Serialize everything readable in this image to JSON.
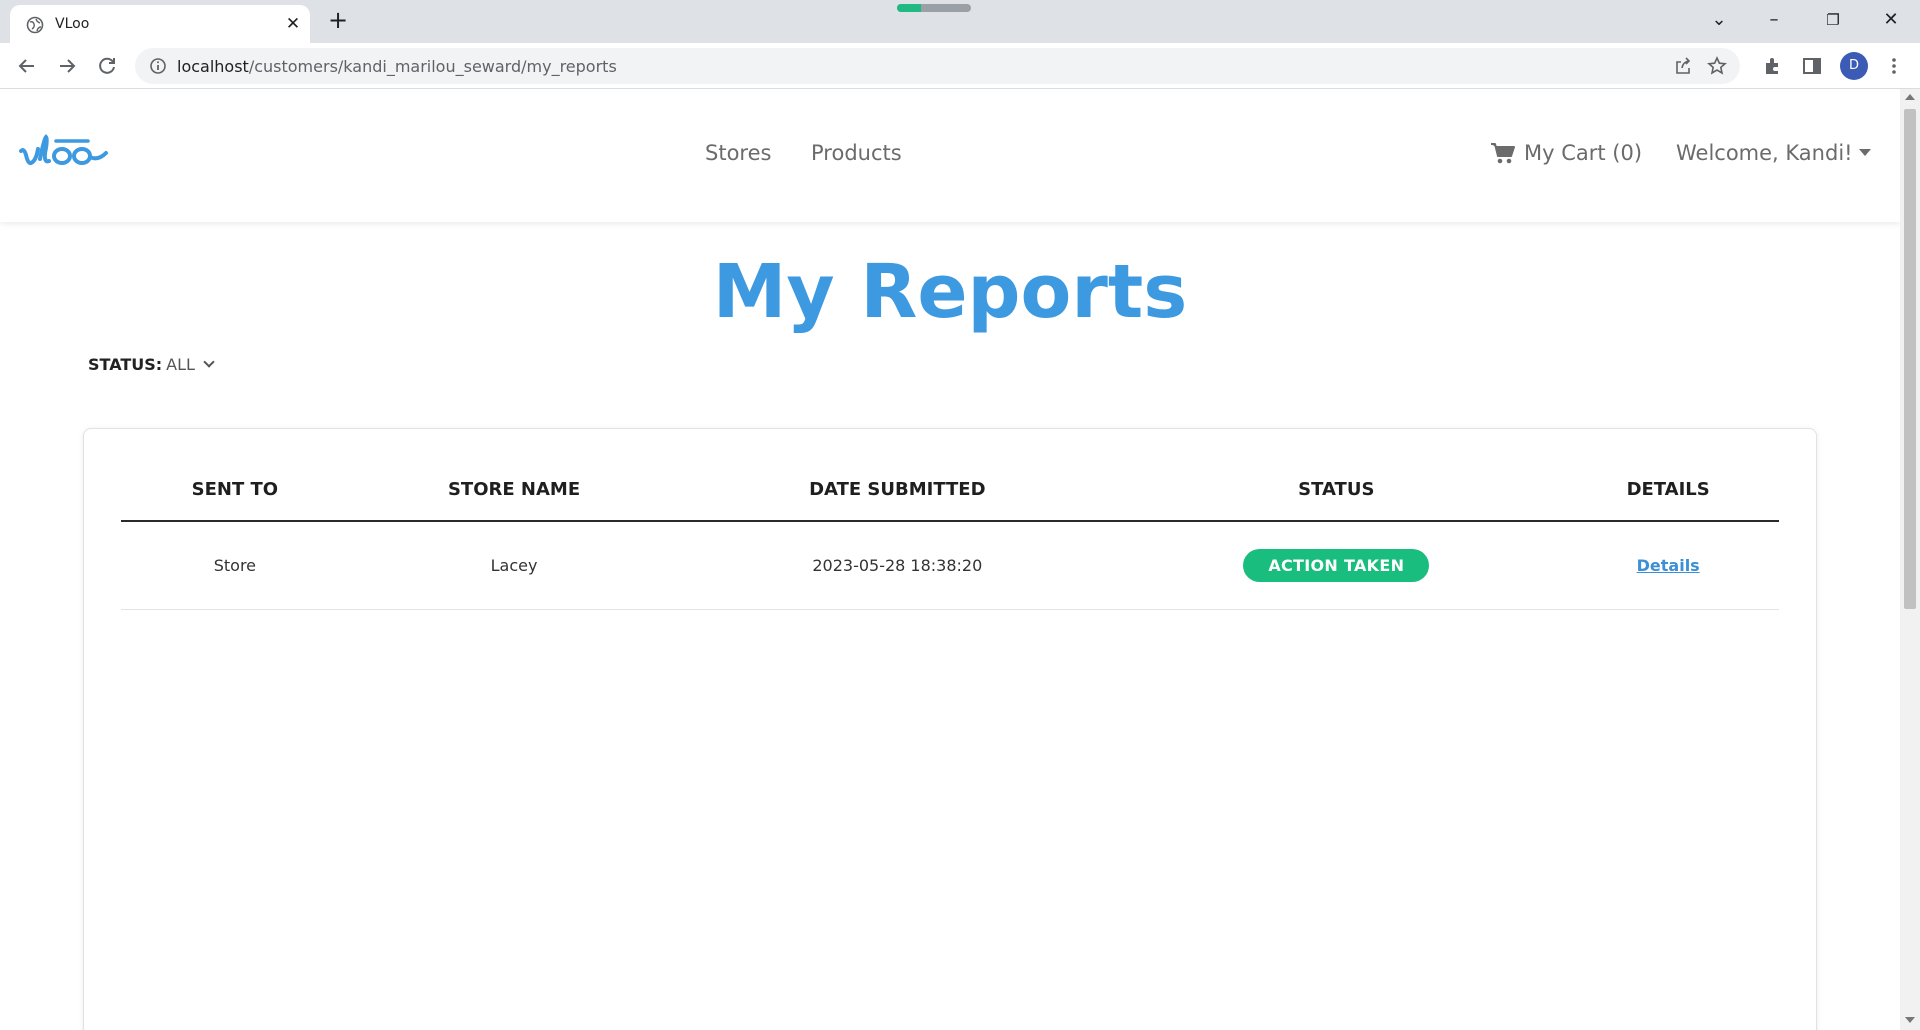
{
  "browser": {
    "tab_title": "VLoo",
    "url_host": "localhost",
    "url_path": "/customers/kandi_marilou_seward/my_reports",
    "profile_initial": "D"
  },
  "nav": {
    "logo_text": "vloo",
    "links": [
      "Stores",
      "Products"
    ],
    "cart_label": "My Cart (0)",
    "welcome": "Welcome, Kandi!"
  },
  "page": {
    "title": "My Reports",
    "status_label": "STATUS:",
    "status_value": "ALL"
  },
  "table": {
    "headers": [
      "SENT TO",
      "STORE NAME",
      "DATE SUBMITTED",
      "STATUS",
      "DETAILS"
    ],
    "rows": [
      {
        "sent_to": "Store",
        "store_name": "Lacey",
        "date_submitted": "2023-05-28 18:38:20",
        "status": "ACTION TAKEN",
        "details": "Details"
      }
    ]
  },
  "colors": {
    "brand_blue": "#3d9ae0",
    "status_green": "#19bd7d",
    "link_blue": "#3d8fd6"
  },
  "icons": [
    "globe-icon",
    "close-icon",
    "plus-icon",
    "back-icon",
    "forward-icon",
    "reload-icon",
    "info-icon",
    "share-icon",
    "star-icon",
    "extensions-icon",
    "side-panel-icon",
    "kebab-menu-icon",
    "cart-icon",
    "chevron-down-icon"
  ]
}
